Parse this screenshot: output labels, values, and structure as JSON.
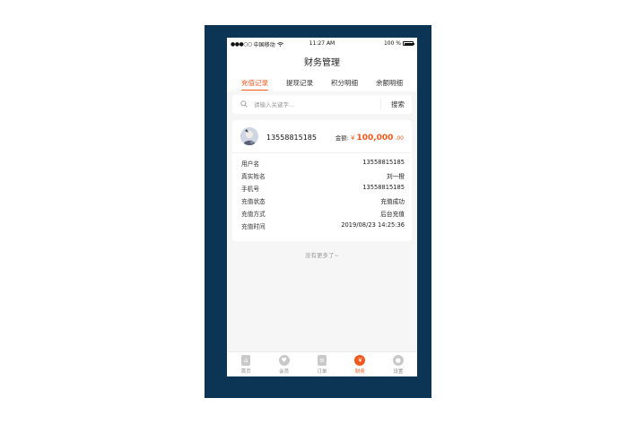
{
  "status_bar": {
    "signal": "●●●○○",
    "carrier": "中国移动",
    "time": "11:27 AM",
    "battery": "100 %"
  },
  "header": {
    "title": "财务管理"
  },
  "tabs": [
    {
      "label": "充值记录",
      "active": true
    },
    {
      "label": "提现记录",
      "active": false
    },
    {
      "label": "积分明细",
      "active": false
    },
    {
      "label": "余额明细",
      "active": false
    }
  ],
  "search": {
    "placeholder": "请输入关键字...",
    "value": "",
    "button_label": "搜索"
  },
  "record": {
    "phone": "13558815185",
    "amount_label": "金额:",
    "currency": "¥",
    "amount_int": "100,000",
    "amount_dec": ".00",
    "fields": [
      {
        "label": "用户名",
        "value": "13558815185"
      },
      {
        "label": "真实姓名",
        "value": "刘一橙"
      },
      {
        "label": "手机号",
        "value": "13558815185"
      },
      {
        "label": "充值状态",
        "value": "充值成功"
      },
      {
        "label": "充值方式",
        "value": "后台充值"
      },
      {
        "label": "充值时间",
        "value": "2019/08/23   14:25:36"
      }
    ]
  },
  "no_more": "没有更多了~",
  "tabbar": [
    {
      "label": "首页",
      "icon": "home-icon",
      "active": false
    },
    {
      "label": "会员",
      "icon": "member-icon",
      "active": false
    },
    {
      "label": "订单",
      "icon": "order-icon",
      "active": false
    },
    {
      "label": "财务",
      "icon": "yen-icon",
      "active": true
    },
    {
      "label": "设置",
      "icon": "settings-icon",
      "active": false
    }
  ],
  "colors": {
    "accent": "#f0581d",
    "frame": "#0c3455",
    "background": "#f6f6f6"
  }
}
